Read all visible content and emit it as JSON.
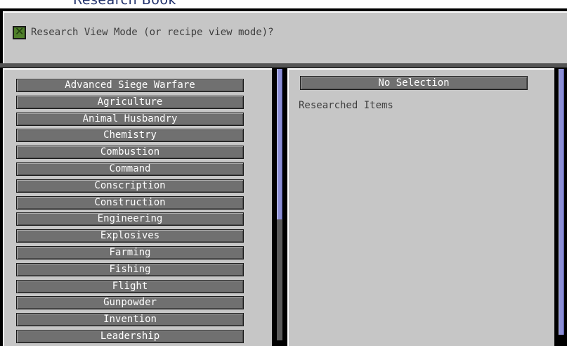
{
  "window": {
    "title": "Research Book"
  },
  "header": {
    "checkbox_checked": true,
    "checkbox_label": "Research View Mode (or recipe view mode)?"
  },
  "categories": [
    "Advanced Siege Warfare",
    "Agriculture",
    "Animal Husbandry",
    "Chemistry",
    "Combustion",
    "Command",
    "Conscription",
    "Construction",
    "Engineering",
    "Explosives",
    "Farming",
    "Fishing",
    "Flight",
    "Gunpowder",
    "Invention",
    "Leadership"
  ],
  "detail": {
    "selection_label": "No Selection",
    "researched_label": "Researched Items"
  },
  "colors": {
    "panel": "#c6c6c6",
    "button": "#707070",
    "scroll_thumb": "#8c8fd6",
    "checkbox_fill": "#4f7f2a"
  }
}
